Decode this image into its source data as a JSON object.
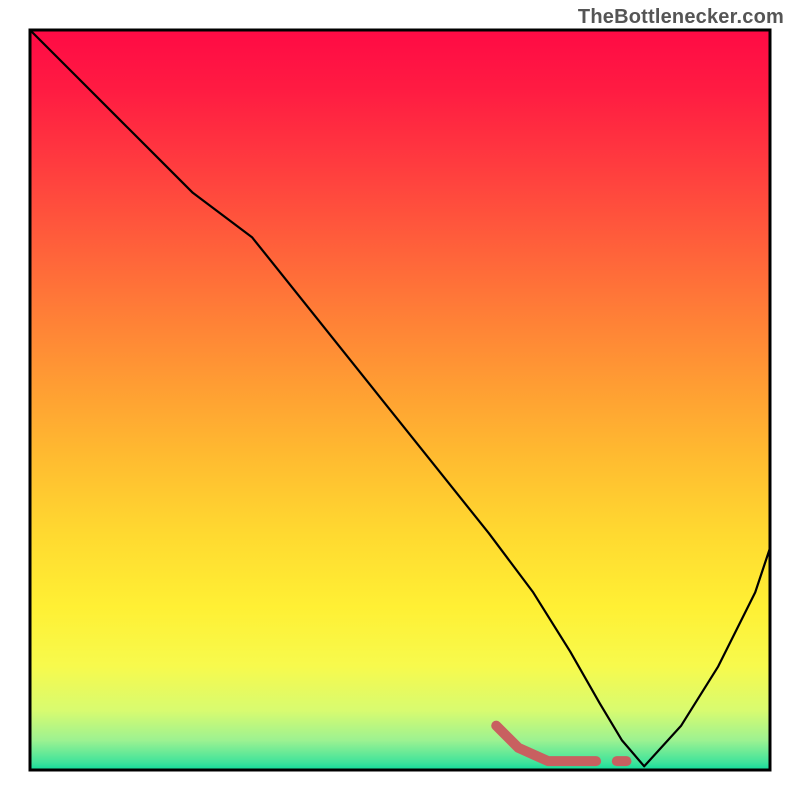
{
  "attribution": "TheBottlenecker.com",
  "chart_data": {
    "type": "line",
    "title": "",
    "xlabel": "",
    "ylabel": "",
    "xlim": [
      0,
      100
    ],
    "ylim": [
      0,
      100
    ],
    "grid": false,
    "background_gradient": {
      "stops": [
        {
          "offset": 0.0,
          "color": "#ff0a45"
        },
        {
          "offset": 0.08,
          "color": "#ff1b42"
        },
        {
          "offset": 0.18,
          "color": "#ff3b3f"
        },
        {
          "offset": 0.28,
          "color": "#ff5c3b"
        },
        {
          "offset": 0.38,
          "color": "#ff7d37"
        },
        {
          "offset": 0.48,
          "color": "#ff9d33"
        },
        {
          "offset": 0.58,
          "color": "#ffbc30"
        },
        {
          "offset": 0.68,
          "color": "#ffd930"
        },
        {
          "offset": 0.78,
          "color": "#fff034"
        },
        {
          "offset": 0.86,
          "color": "#f7fa4d"
        },
        {
          "offset": 0.92,
          "color": "#d8fb70"
        },
        {
          "offset": 0.96,
          "color": "#9cf291"
        },
        {
          "offset": 0.99,
          "color": "#3fe39b"
        },
        {
          "offset": 1.0,
          "color": "#10dc9b"
        }
      ]
    },
    "series": [
      {
        "name": "bottleneck-curve",
        "color": "#000000",
        "width": 2.2,
        "x": [
          0,
          6,
          12,
          18,
          22,
          26,
          30,
          38,
          46,
          54,
          62,
          68,
          73,
          77,
          80,
          83,
          88,
          93,
          98,
          100
        ],
        "y": [
          100,
          94,
          88,
          82,
          78,
          75,
          72,
          62,
          52,
          42,
          32,
          24,
          16,
          9,
          4,
          0.5,
          6,
          14,
          24,
          30
        ]
      },
      {
        "name": "target-range-marker",
        "color": "#c86060",
        "width": 10,
        "linecap": "round",
        "dash": null,
        "x": [
          63,
          66,
          70,
          72,
          73.5,
          75,
          76.5
        ],
        "y": [
          6,
          3,
          1.2,
          1.2,
          1.2,
          1.2,
          1.2
        ]
      },
      {
        "name": "target-range-marker-gap",
        "color": "#c86060",
        "width": 10,
        "linecap": "round",
        "x": [
          79.3,
          80.6
        ],
        "y": [
          1.2,
          1.2
        ]
      }
    ]
  }
}
